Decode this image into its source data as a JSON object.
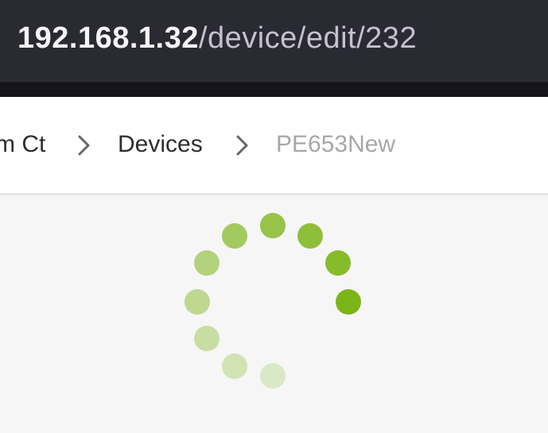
{
  "address_bar": {
    "host": "192.168.1.32",
    "path": "/device/edit/232"
  },
  "breadcrumb": {
    "items": [
      "m Ct",
      "Devices",
      "PE653New"
    ],
    "separator_icon": "chevron-right-icon"
  },
  "loading_spinner": {
    "icon": "loading-spinner-icon",
    "color": "#7cb518"
  },
  "colors": {
    "urlbar_bg": "#2a2a33",
    "accent": "#7cb518"
  }
}
